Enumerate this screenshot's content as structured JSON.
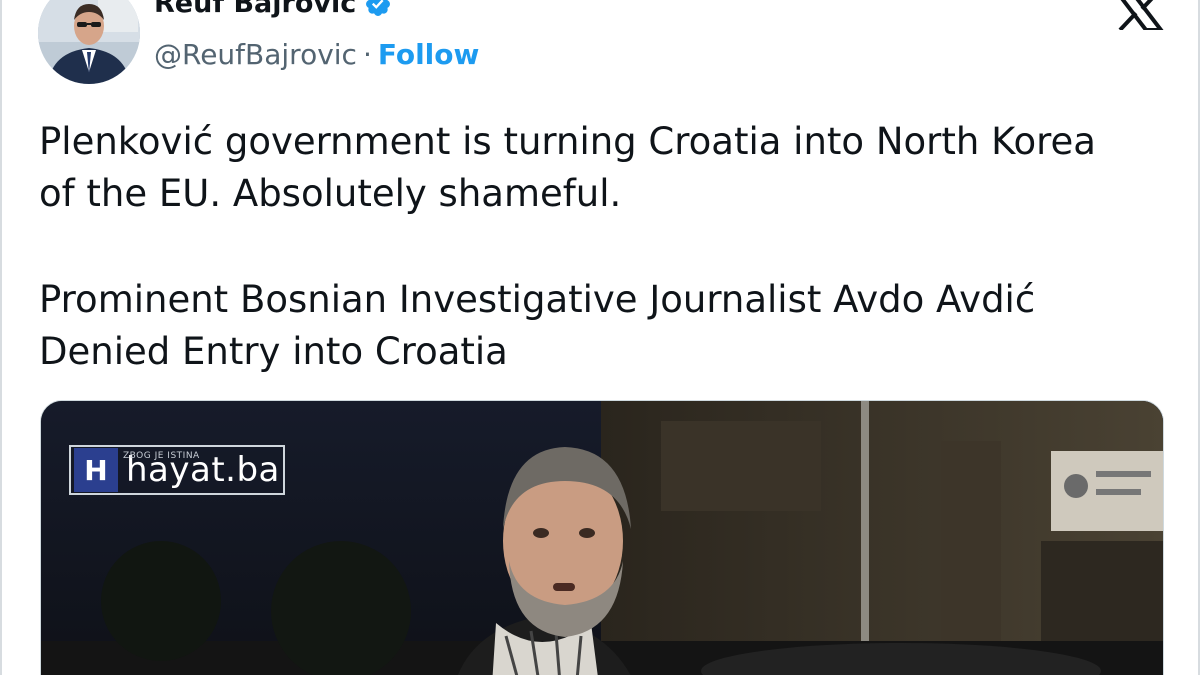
{
  "author": {
    "name": "Reuf Bajrovic",
    "handle": "@ReufBajrovic",
    "separator": "·",
    "follow_label": "Follow"
  },
  "icons": {
    "verified": "verified-badge-icon",
    "platform_logo": "x-logo-icon"
  },
  "colors": {
    "accent": "#1d9bf0",
    "text": "#0f1419",
    "secondary_text": "#536471"
  },
  "tweet": {
    "line1": "Plenković government is turning Croatia into North Korea",
    "line2": "of the EU. Absolutely shameful.",
    "line3": "Prominent Bosnian Investigative Journalist Avdo Avdić",
    "line4": "Denied Entry into Croatia"
  },
  "media": {
    "watermark_badge": "H",
    "watermark_text": "hayat.ba",
    "watermark_small": "ZBOG JE ISTINA"
  }
}
